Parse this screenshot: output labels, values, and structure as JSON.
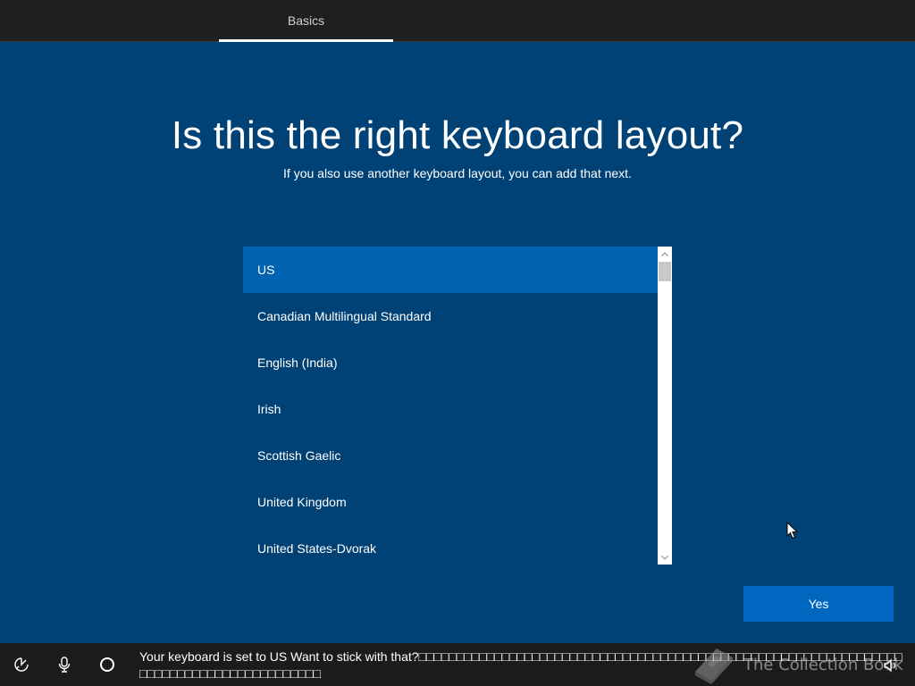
{
  "header": {
    "tab_label": "Basics"
  },
  "main": {
    "title": "Is this the right keyboard layout?",
    "subtitle": "If you also use another keyboard layout, you can add that next."
  },
  "layouts": {
    "selected_index": 0,
    "items": [
      {
        "label": "US"
      },
      {
        "label": "Canadian Multilingual Standard"
      },
      {
        "label": "English (India)"
      },
      {
        "label": "Irish"
      },
      {
        "label": "Scottish Gaelic"
      },
      {
        "label": "United Kingdom"
      },
      {
        "label": "United States-Dvorak"
      }
    ]
  },
  "actions": {
    "yes_label": "Yes"
  },
  "bottom_bar": {
    "caption": "Your keyboard is set to US Want to stick with that?□□□□□□□□□□□□□□□□□□□□□□□□□□□□□□□□□□□□□□□□□□□□□□□□□□□□□□□□□□□□□□□□□□□□□□□□□□□□□□□□□□□□□□□□",
    "icons": [
      "ease-of-access-icon",
      "microphone-icon",
      "cortana-icon",
      "volume-icon"
    ]
  },
  "watermark": {
    "text": "The Collection Book"
  },
  "colors": {
    "background": "#004275",
    "selected": "#0063b1",
    "button": "#0067c0",
    "topbar": "#1f1f1f",
    "bottombar": "#1b1b1b"
  }
}
